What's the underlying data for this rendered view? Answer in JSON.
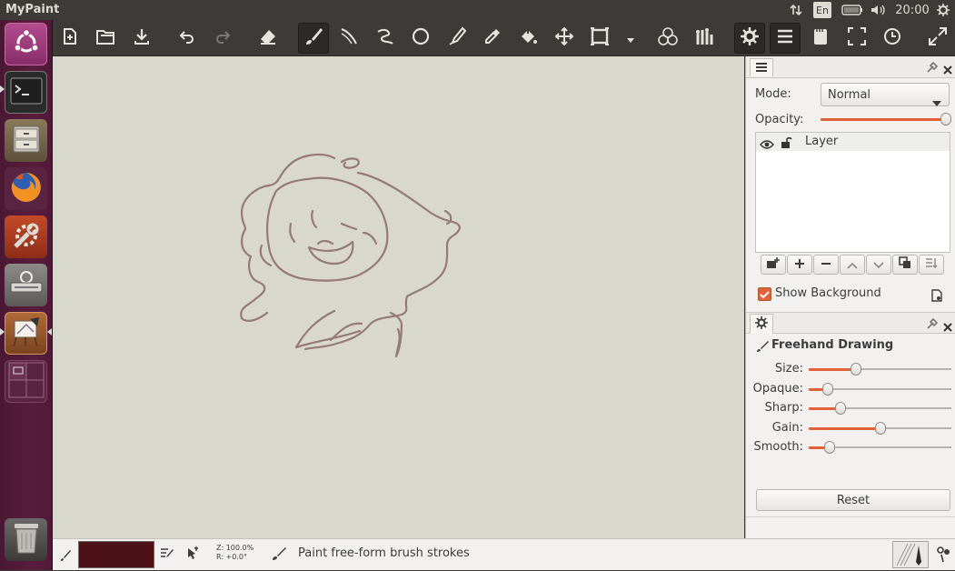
{
  "topbar": {
    "app_title": "MyPaint",
    "keyboard_layout": "En",
    "clock": "20:00",
    "icons": [
      "network-arrows-icon",
      "battery-icon",
      "volume-icon",
      "system-gear-icon"
    ]
  },
  "launcher": {
    "items": [
      {
        "name": "ubuntu-dash-button",
        "icon": "ubuntu-logo-icon"
      },
      {
        "name": "terminal-launcher",
        "icon": "terminal-icon"
      },
      {
        "name": "files-launcher",
        "icon": "file-cabinet-icon"
      },
      {
        "name": "firefox-launcher",
        "icon": "firefox-icon"
      },
      {
        "name": "system-settings-launcher",
        "icon": "settings-wrench-icon"
      },
      {
        "name": "removable-drive-launcher",
        "icon": "drive-icon"
      },
      {
        "name": "mypaint-launcher",
        "icon": "mypaint-easel-icon"
      },
      {
        "name": "workspace-switcher-launcher",
        "icon": "workspaces-icon"
      },
      {
        "name": "trash-launcher",
        "icon": "trash-icon"
      }
    ]
  },
  "toolbar": {
    "buttons": [
      "new-icon",
      "open-icon",
      "save-icon",
      "undo-icon",
      "redo-icon",
      "eraser-icon",
      "freehand-brush-icon",
      "inking-icon",
      "connected-lines-icon",
      "ellipse-icon",
      "pen-icon",
      "color-picker-icon",
      "fill-icon",
      "move-icon",
      "frame-icon",
      "more-dropdown-icon",
      "color-circles-icon",
      "brush-set-icon",
      "settings-gear-icon",
      "main-menu-icon",
      "scratchpad-icon",
      "fullscreen-icon",
      "history-icon",
      "expand-icon"
    ]
  },
  "layers_panel": {
    "mode_label": "Mode:",
    "mode_value": "Normal",
    "opacity_label": "Opacity:",
    "opacity_fraction": 1.0,
    "layer_name": "Layer",
    "show_background_label": "Show Background",
    "show_background_checked": true
  },
  "brush_panel": {
    "title": "Freehand Drawing",
    "sliders": [
      {
        "label": "Size:",
        "value": 0.32
      },
      {
        "label": "Opaque:",
        "value": 0.1
      },
      {
        "label": "Sharp:",
        "value": 0.2
      },
      {
        "label": "Gain:",
        "value": 0.5
      },
      {
        "label": "Smooth:",
        "value": 0.12
      }
    ],
    "reset_label": "Reset"
  },
  "statusbar": {
    "color_hex": "#4d1218",
    "zoom_text": "Z: 100.0%",
    "rotation_text": "R: +0.0°",
    "message": "Paint free-form brush strokes"
  },
  "colors": {
    "accent": "#e0613a",
    "canvas": "#d9d8cf",
    "stroke": "#8a6a66"
  }
}
